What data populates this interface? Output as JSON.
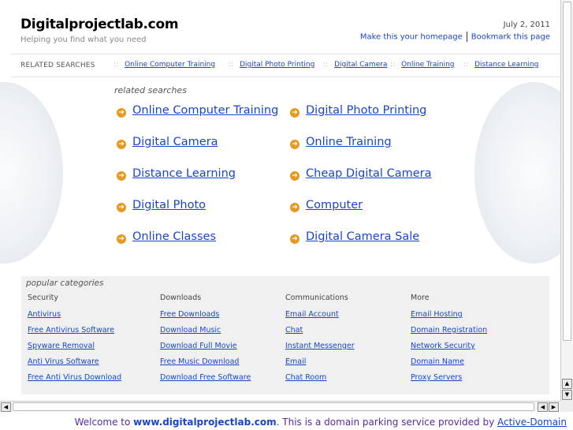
{
  "header": {
    "site_title": "Digitalprojectlab.com",
    "tagline": "Helping you find what you need",
    "date": "July 2, 2011",
    "homepage_link": "Make this your homepage",
    "bookmark_link": "Bookmark this page"
  },
  "related_bar": {
    "label": "RELATED SEARCHES",
    "separator": "::",
    "items": [
      "Online Computer Training",
      "Digital Photo Printing",
      "Digital Camera",
      "Online Training",
      "Distance Learning"
    ]
  },
  "related_searches": {
    "heading": "related searches",
    "left": [
      "Online Computer Training",
      "Digital Camera",
      "Distance Learning",
      "Digital Photo",
      "Online Classes"
    ],
    "right": [
      "Digital Photo Printing",
      "Online Training",
      "Cheap Digital Camera",
      "Computer",
      "Digital Camera Sale"
    ]
  },
  "popular": {
    "title": "popular categories",
    "columns": [
      {
        "head": "Security",
        "links": [
          "Antivirus",
          "Free Antivirus Software",
          "Spyware Removal",
          "Anti Virus Software",
          "Free Anti Virus Download"
        ]
      },
      {
        "head": "Downloads",
        "links": [
          "Free Downloads",
          "Download Music",
          "Download Full Movie",
          "Free Music Download",
          "Download Free Software"
        ]
      },
      {
        "head": "Communications",
        "links": [
          "Email Account",
          "Chat",
          "Instant Messenger",
          "Email",
          "Chat Room"
        ]
      },
      {
        "head": "More",
        "links": [
          "Email Hosting",
          "Domain Registration",
          "Network Security",
          "Domain Name",
          "Proxy Servers"
        ]
      }
    ]
  },
  "footer": {
    "prefix": "Welcome to ",
    "domain": "www.digitalprojectlab.com",
    "middle": ". This is a domain parking service provided by ",
    "provider": "Active-Domain"
  },
  "icons": {
    "arrow": "circle-arrow-right-icon",
    "scroll_up": "scroll-up-arrow-icon",
    "scroll_down": "scroll-down-arrow-icon",
    "scroll_left": "scroll-left-arrow-icon",
    "scroll_right": "scroll-right-arrow-icon"
  },
  "colors": {
    "link": "#1a45c8",
    "arrow": "#e59b22",
    "footer_text": "#5a2aa0"
  }
}
